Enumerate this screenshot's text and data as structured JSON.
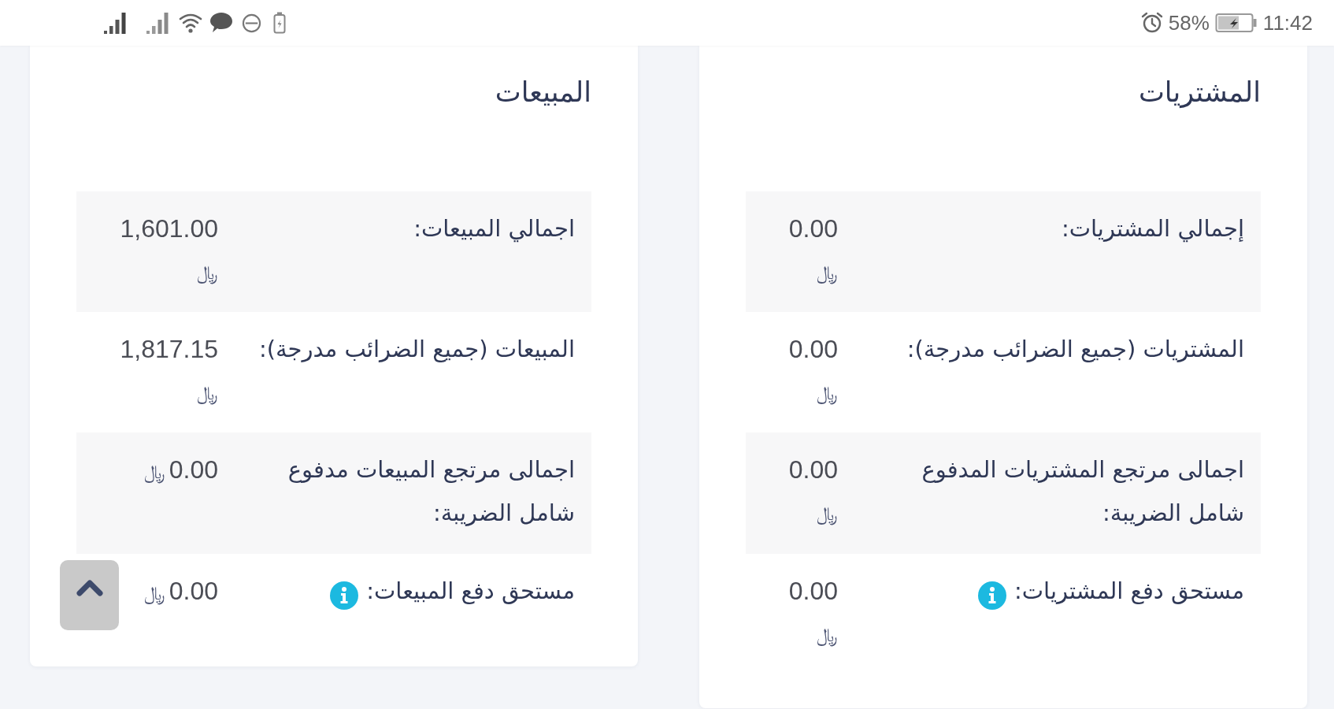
{
  "status_bar": {
    "battery": "58%",
    "time": "11:42"
  },
  "cards": [
    {
      "title": "المشتريات",
      "rows": [
        {
          "label": "إجمالي المشتريات:",
          "amount": "0.00",
          "currency": "﷼",
          "info": false
        },
        {
          "label": "المشتريات (جميع الضرائب مدرجة):",
          "amount": "0.00",
          "currency": "﷼",
          "info": false
        },
        {
          "label": "اجمالى مرتجع المشتريات المدفوع شامل الضريبة:",
          "amount": "0.00",
          "currency": "﷼",
          "info": false
        },
        {
          "label": "مستحق دفع المشتريات:",
          "amount": "0.00",
          "currency": "﷼",
          "info": true
        }
      ]
    },
    {
      "title": "المبيعات",
      "rows": [
        {
          "label": "اجمالي المبيعات:",
          "amount": "1,601.00",
          "currency": "﷼",
          "info": false
        },
        {
          "label": "المبيعات (جميع الضرائب مدرجة):",
          "amount": "1,817.15",
          "currency": "﷼",
          "info": false
        },
        {
          "label": "اجمالى مرتجع المبيعات مدفوع شامل الضريبة:",
          "amount": "0.00",
          "currency": "﷼",
          "info": false
        },
        {
          "label": "مستحق دفع المبيعات:",
          "amount": "0.00",
          "currency": "﷼",
          "info": true
        }
      ]
    }
  ]
}
